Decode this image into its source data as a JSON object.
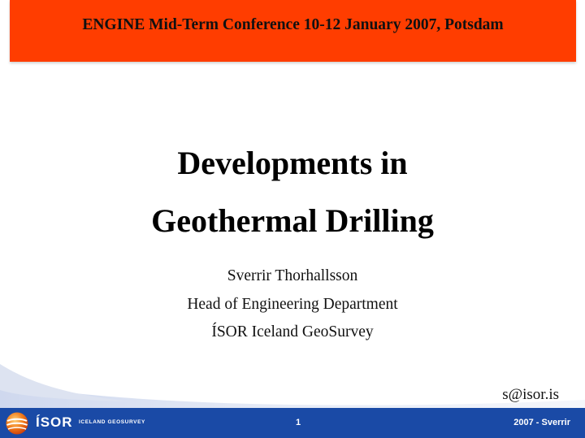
{
  "header": {
    "text": "ENGINE Mid-Term Conference 10-12 January 2007, Potsdam",
    "color": "#ff3d00"
  },
  "title": {
    "line1": "Developments in",
    "line2": "Geothermal Drilling"
  },
  "author": {
    "name": "Sverrir Thorhallsson",
    "position": "Head of Engineering Department",
    "organization": "ÍSOR Iceland GeoSurvey",
    "email": "s@isor.is"
  },
  "footer": {
    "logo_text": "ÍSOR",
    "logo_tagline": "ICELAND GEOSURVEY",
    "page_number": "1",
    "right_text": "2007 - Sverrir",
    "bar_color": "#1a4aa6"
  }
}
